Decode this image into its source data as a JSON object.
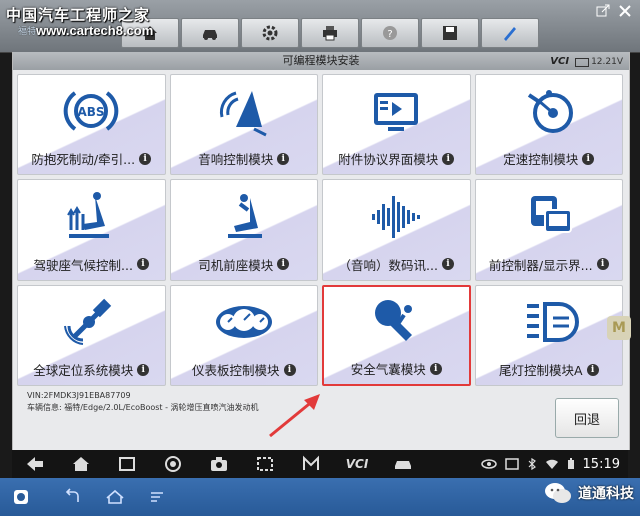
{
  "watermark": {
    "site_name": "中国汽车工程师之家",
    "site_url": "www.cartech8.com",
    "brand": "福特"
  },
  "toolbar": {
    "buttons": [
      {
        "icon": "home-icon"
      },
      {
        "icon": "car-icon"
      },
      {
        "icon": "gear-icon"
      },
      {
        "icon": "printer-icon"
      },
      {
        "icon": "help-icon"
      },
      {
        "icon": "save-icon"
      },
      {
        "icon": "pen-icon"
      }
    ]
  },
  "header": {
    "title": "可编程模块安装",
    "vci_logo": "VCI",
    "voltage": "12.21V"
  },
  "modules": [
    {
      "label": "防抱死制动/牵引...",
      "icon": "abs-icon"
    },
    {
      "label": "音响控制模块",
      "icon": "audio-control-icon"
    },
    {
      "label": "附件协议界面模块",
      "icon": "accessory-interface-icon"
    },
    {
      "label": "定速控制模块",
      "icon": "cruise-control-icon"
    },
    {
      "label": "驾驶座气候控制...",
      "icon": "seat-climate-icon"
    },
    {
      "label": "司机前座模块",
      "icon": "driver-seat-icon"
    },
    {
      "label": "（音响）数码讯...",
      "icon": "sound-wave-icon"
    },
    {
      "label": "前控制器/显示界...",
      "icon": "front-controller-icon"
    },
    {
      "label": "全球定位系统模块",
      "icon": "gps-satellite-icon"
    },
    {
      "label": "仪表板控制模块",
      "icon": "instrument-cluster-icon"
    },
    {
      "label": "安全气囊模块",
      "icon": "airbag-icon",
      "selected": true
    },
    {
      "label": "尾灯控制模块A",
      "icon": "tail-light-icon"
    }
  ],
  "vehicle": {
    "vin": "VIN:2FMDK3J91EBA87709",
    "info": "车辆信息: 福特/Edge/2.0L/EcoBoost - 涡轮增压直喷汽油发动机"
  },
  "back_button": {
    "label": "回退"
  },
  "side_tab": {
    "label": "M"
  },
  "appbar": {
    "vci_label": "VCI",
    "clock": "15:19"
  },
  "wechat": {
    "account": "道通科技"
  },
  "colors": {
    "selected_border": "#e23a3a",
    "arrow": "#e23a3a",
    "icon_blue": "#1e5aa8",
    "navbar": "#3a6fb0"
  }
}
